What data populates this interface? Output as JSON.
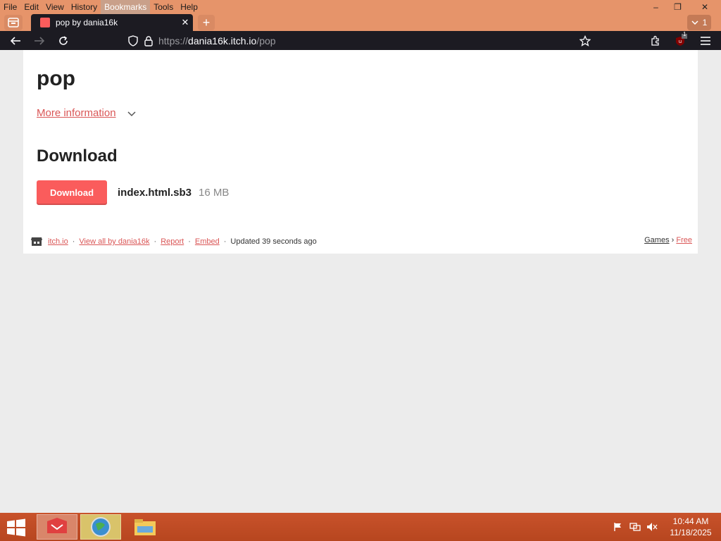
{
  "menubar": {
    "items": [
      {
        "label": "File"
      },
      {
        "label": "Edit"
      },
      {
        "label": "View"
      },
      {
        "label": "History"
      },
      {
        "label": "Bookmarks"
      },
      {
        "label": "Tools"
      },
      {
        "label": "Help"
      }
    ]
  },
  "window_controls": {
    "minimize": "–",
    "restore": "❐",
    "close": "✕"
  },
  "tabs": {
    "active_title": "pop by dania16k",
    "close_glyph": "✕",
    "new_tab_glyph": "+",
    "tab_list_count": "1"
  },
  "navbar": {
    "url_prefix": "https://",
    "url_domain": "dania16k.itch.io",
    "url_path": "/pop",
    "extension_badge": "1"
  },
  "page": {
    "title": "pop",
    "more_information": "More information",
    "download_heading": "Download",
    "download_button": "Download",
    "file_name": "index.html.sb3",
    "file_size": "16 MB"
  },
  "footer": {
    "itch_link": "itch.io",
    "view_all": "View all by dania16k",
    "report": "Report",
    "embed": "Embed",
    "updated": "Updated 39 seconds ago",
    "games": "Games",
    "crumb_sep": "›",
    "free": "Free",
    "dot": "·"
  },
  "taskbar": {
    "time": "10:44 AM",
    "date": "11/18/2025"
  },
  "colors": {
    "accent": "#fa5c5c",
    "link": "#da5656",
    "titlebar": "#e6946a",
    "taskbar": "#c8522b"
  }
}
